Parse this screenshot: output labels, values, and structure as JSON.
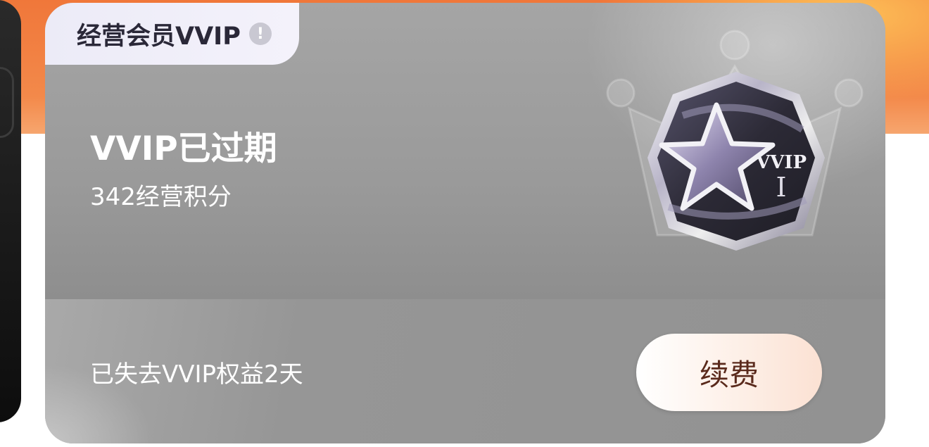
{
  "card": {
    "tag_label": "经营会员VVIP",
    "info_icon_glyph": "!",
    "status_title": "VVIP已过期",
    "points_text": "342经营积分",
    "badge": {
      "line1": "VVIP",
      "line2": "I"
    },
    "lost_text": "已失去VVIP权益2天",
    "renew_label": "续费"
  },
  "icons": [
    "info-icon",
    "crown-icon",
    "vvip-badge-icon"
  ],
  "colors": {
    "backdrop_orange": "#f0773a",
    "card_gray": "#a0a0a0",
    "tag_bg": "#ecebf7",
    "renew_text": "#5a2a1c"
  }
}
